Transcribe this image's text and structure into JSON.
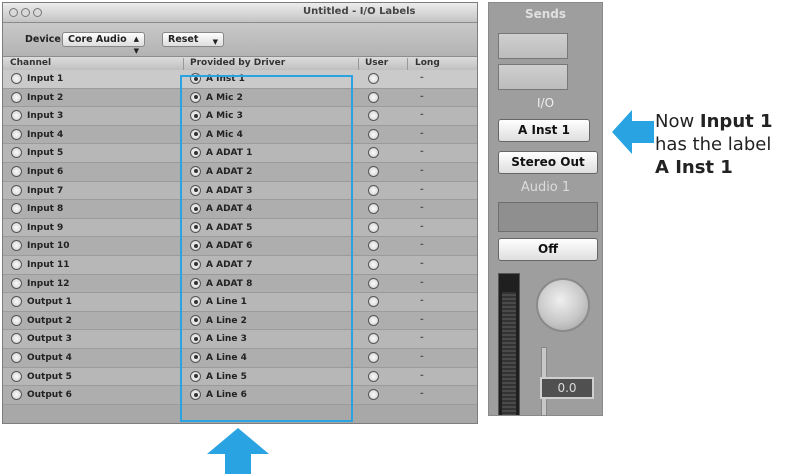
{
  "window": {
    "title": "Untitled - I/O Labels",
    "device_label": "Device:",
    "device_value": "Core Audio",
    "reset_label": "Reset",
    "columns": [
      "Channel",
      "Provided by Driver",
      "User",
      "Long"
    ],
    "rows": [
      {
        "channel": "Input 1",
        "driver": "A Inst 1",
        "long": "-"
      },
      {
        "channel": "Input 2",
        "driver": "A Mic 2",
        "long": "-"
      },
      {
        "channel": "Input 3",
        "driver": "A Mic 3",
        "long": "-"
      },
      {
        "channel": "Input 4",
        "driver": "A Mic 4",
        "long": "-"
      },
      {
        "channel": "Input 5",
        "driver": "A ADAT 1",
        "long": "-"
      },
      {
        "channel": "Input 6",
        "driver": "A ADAT 2",
        "long": "-"
      },
      {
        "channel": "Input 7",
        "driver": "A ADAT 3",
        "long": "-"
      },
      {
        "channel": "Input 8",
        "driver": "A ADAT 4",
        "long": "-"
      },
      {
        "channel": "Input 9",
        "driver": "A ADAT 5",
        "long": "-"
      },
      {
        "channel": "Input 10",
        "driver": "A ADAT 6",
        "long": "-"
      },
      {
        "channel": "Input 11",
        "driver": "A ADAT 7",
        "long": "-"
      },
      {
        "channel": "Input 12",
        "driver": "A ADAT 8",
        "long": "-"
      },
      {
        "channel": "Output 1",
        "driver": "A Line 1",
        "long": "-"
      },
      {
        "channel": "Output 2",
        "driver": "A Line 2",
        "long": "-"
      },
      {
        "channel": "Output 3",
        "driver": "A Line 3",
        "long": "-"
      },
      {
        "channel": "Output 4",
        "driver": "A Line 4",
        "long": "-"
      },
      {
        "channel": "Output 5",
        "driver": "A Line 5",
        "long": "-"
      },
      {
        "channel": "Output 6",
        "driver": "A Line 6",
        "long": "-"
      }
    ]
  },
  "strip": {
    "sends_label": "Sends",
    "io_label": "I/O",
    "input_button": "A Inst 1",
    "output_button": "Stereo Out",
    "channel_name": "Audio 1",
    "automation_button": "Off",
    "fader_value": "0.0"
  },
  "annotation": {
    "line1_prefix": "Now ",
    "line1_bold": "Input 1",
    "line2": "has the label",
    "line3_bold": "A Inst 1"
  },
  "colors": {
    "highlight": "#2aa3e0",
    "arrow": "#29a3e2"
  }
}
